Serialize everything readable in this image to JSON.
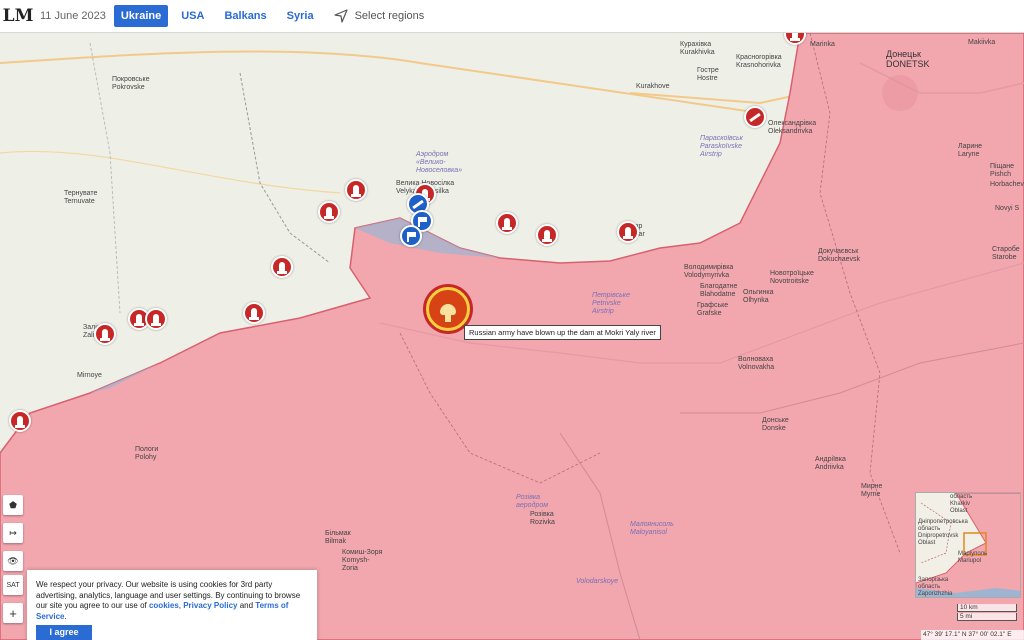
{
  "header": {
    "logo": "LM",
    "date": "11 June 2023",
    "tabs": [
      {
        "label": "Ukraine",
        "active": true
      },
      {
        "label": "USA",
        "active": false
      },
      {
        "label": "Balkans",
        "active": false
      },
      {
        "label": "Syria",
        "active": false
      }
    ],
    "select_regions": "Select regions"
  },
  "map": {
    "colors": {
      "occupied": "#f2a6ae",
      "occupied_stroke": "#d9606e",
      "water": "#9fb4d1",
      "land": "#eef0e8",
      "marker_red": "#c62828",
      "marker_blue": "#1e5fc8"
    },
    "places": [
      {
        "text": "Покровське\nPokrovske"
      },
      {
        "text": "Тернувате\nTernuvate"
      },
      {
        "text": "Заліз\nZali"
      },
      {
        "text": "Mirnoye"
      },
      {
        "text": "Пологи\nPolohy"
      },
      {
        "text": "Аэродром\n«Велико-\nНовоселовка»"
      },
      {
        "text": "Велика Новосілка\nVelyka Novosilka"
      },
      {
        "text": "Курахівка\nKurakhivka"
      },
      {
        "text": "Красногорівка\nKrasnohorivka"
      },
      {
        "text": "Гостре\nHostre"
      },
      {
        "text": "Kurakhove"
      },
      {
        "text": "Параскоївськ\nParaskoïvske\nAirstrip"
      },
      {
        "text": "Олександрівка\nOleksandrivka"
      },
      {
        "text": "Докучаєвськ\nDokuchaevsk"
      },
      {
        "text": "Новотроїцьке\nNovotroitske"
      },
      {
        "text": "Володимирівка\nVolodymyrivka"
      },
      {
        "text": "Благодатне\nBlahodatne"
      },
      {
        "text": "Графське\nGrafske"
      },
      {
        "text": "Ольгинка\nOlhynka"
      },
      {
        "text": "Петрівське\nPetrivske\nAirstrip"
      },
      {
        "text": "Волноваха\nVolnovakha"
      },
      {
        "text": "Донське\nDonske"
      },
      {
        "text": "Андріївка\nAndriivka"
      },
      {
        "text": "Мирне\nMyrne"
      },
      {
        "text": "Розівка\nаеродром"
      },
      {
        "text": "Розівка\nRozivka"
      },
      {
        "text": "Малоянисоль\nMaloyanisol"
      },
      {
        "text": "Більмак\nBilmak"
      },
      {
        "text": "Комиш-Зоря\nKomysh-\nZoria"
      },
      {
        "text": "Volodarskoye"
      },
      {
        "text": "Донецьк\nDONETSK"
      },
      {
        "text": "Makiivka"
      },
      {
        "text": "Ларине\nLaryne"
      },
      {
        "text": "Старобе\nStarobe"
      },
      {
        "text": "Marinka"
      },
      {
        "text": "Хар\nKhar"
      },
      {
        "text": "Пiщане\nPishch"
      },
      {
        "text": "Horbachev"
      },
      {
        "text": "Novyi S"
      }
    ],
    "dam_tooltip": "Russian army have blown up the dam at Mokri Yaly river",
    "controls": [
      "⬟",
      "↦",
      "👁",
      "SAT",
      "+"
    ]
  },
  "cookie": {
    "text_before": "We respect your privacy. Our website is using cookies for 3rd party advertising, analytics, language and user settings. By continuing to browse our site you agree to our use of ",
    "link_cookies": "cookies",
    "sep": ", ",
    "link_privacy": "Privacy Policy",
    "and": " and ",
    "link_terms": "Terms of Service",
    "end": ".",
    "button": "I agree"
  },
  "minimap": {
    "labels": [
      "область\nKharkiv\nOblast",
      "Дніпропетровська\nобласть\nDnipropetrovsk\nOblast",
      "Маріуполь\nMariupol",
      "Запорізька\nобласть\nZaporizhzhia"
    ]
  },
  "scale": {
    "km": "10 km",
    "mi": "5 mi"
  },
  "coords": "47° 39' 17.1'' N 37° 00' 02.1'' E"
}
